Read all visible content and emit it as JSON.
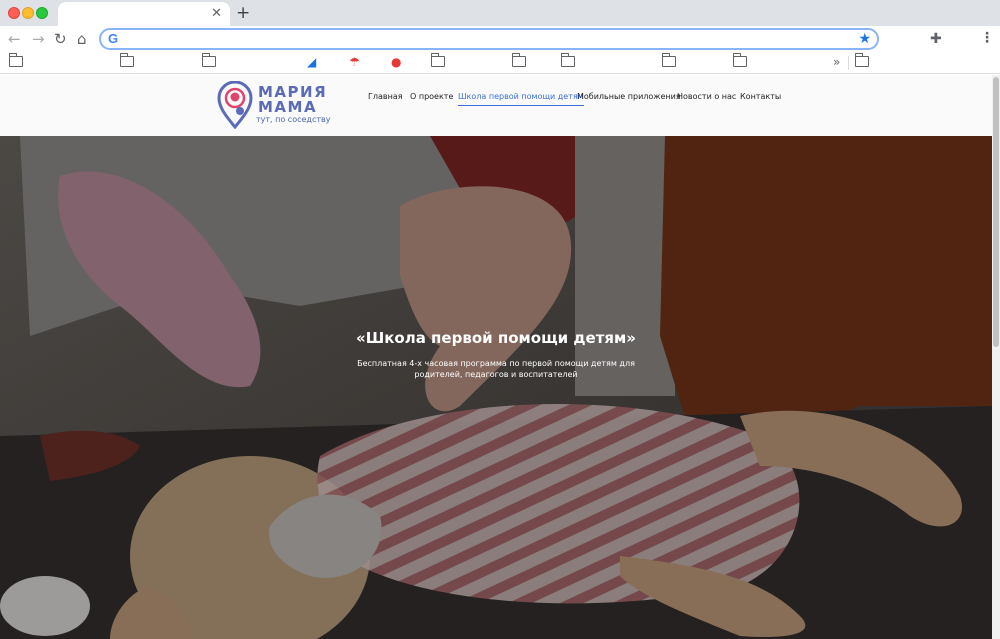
{
  "browser": {
    "tab_close_icon": "close-icon",
    "new_tab_icon": "plus-icon",
    "address": "",
    "bookmarks_overflow": "»"
  },
  "site": {
    "logo": {
      "title_line1": "МАРИЯ",
      "title_line2": "МАМА",
      "tagline": "тут, по соседству",
      "color": "#5b6bb5",
      "accent": "#e0446a"
    },
    "nav": [
      {
        "label": "Главная"
      },
      {
        "label": "О проекте"
      },
      {
        "label": "Школа первой помощи детям",
        "active": true
      },
      {
        "label": "Мобильные приложения"
      },
      {
        "label": "Новости о нас"
      },
      {
        "label": "Контакты"
      }
    ],
    "active_color": "#3b6fd8"
  },
  "hero": {
    "title": "«Школа первой помощи детям»",
    "text": "Бесплатная 4-х часовая  программа по первой помощи детям для родителей, педагогов и воспитателей"
  }
}
